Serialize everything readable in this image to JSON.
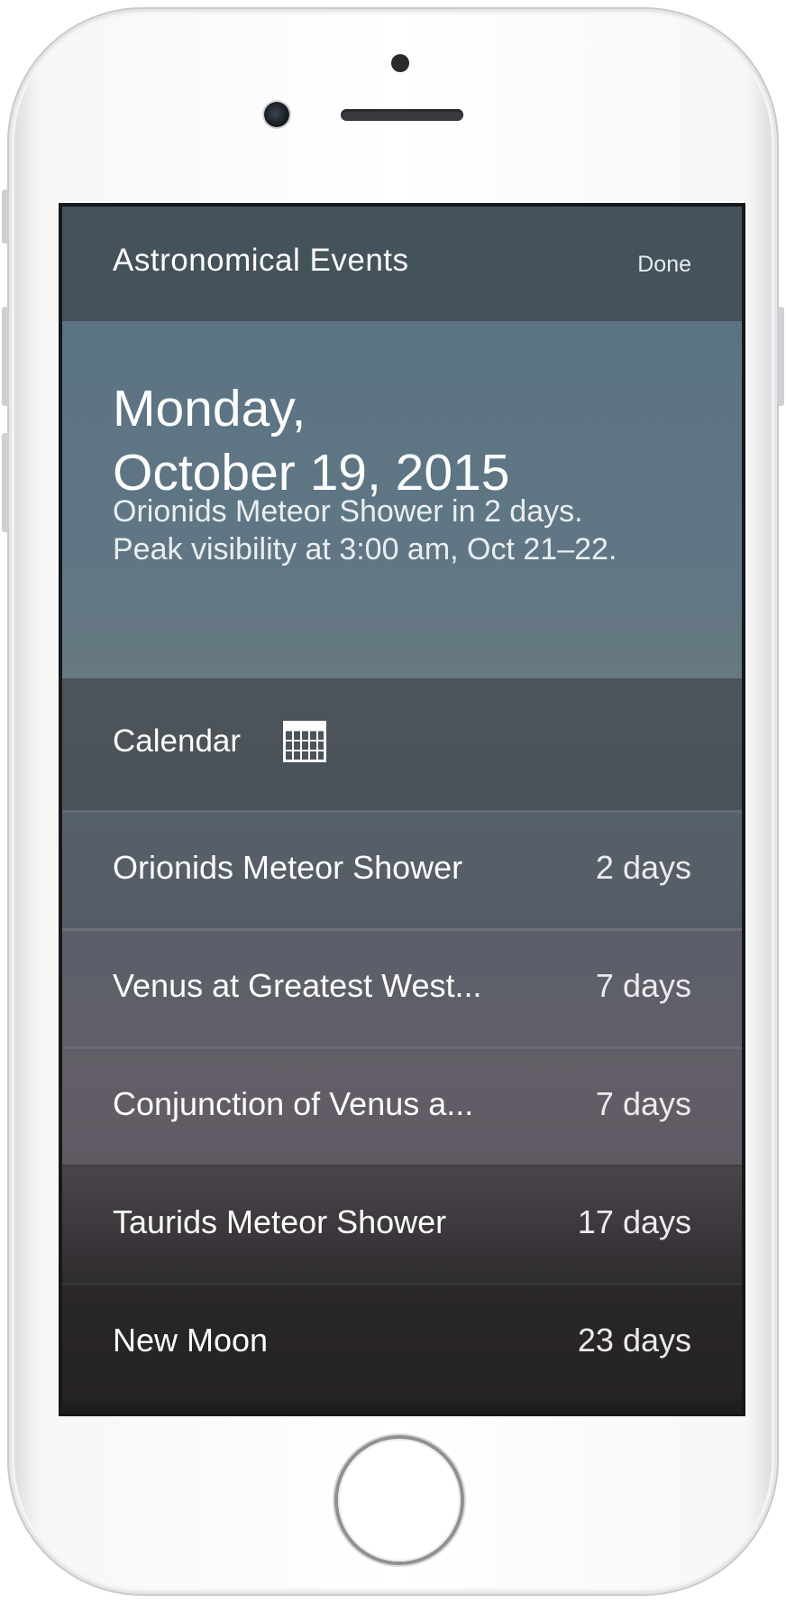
{
  "nav": {
    "title": "Astronomical Events",
    "done_label": "Done"
  },
  "hero": {
    "date_line1": "Monday,",
    "date_line2": "October 19, 2015",
    "info_line1": "Orionids Meteor Shower in 2 days.",
    "info_line2": "Peak visibility at 3:00 am, Oct 21–22."
  },
  "calendar": {
    "label": "Calendar",
    "icon": "calendar-icon"
  },
  "events": [
    {
      "name": "Orionids Meteor Shower",
      "days": "2 days",
      "color": "#56606a"
    },
    {
      "name": "Venus at Greatest West...",
      "days": "7 days",
      "color": "#5f6069"
    },
    {
      "name": "Conjunction of Venus a...",
      "days": "7 days",
      "color": "#625d66"
    },
    {
      "name": "Taurids Meteor Shower",
      "days": "17 days",
      "color": "#3f3b3f"
    },
    {
      "name": "New Moon",
      "days": "23 days",
      "color": "#28252a"
    }
  ],
  "colors": {
    "navbar": "#44525c",
    "hero": "#5f7684",
    "calendar_row": "#4b535a"
  }
}
